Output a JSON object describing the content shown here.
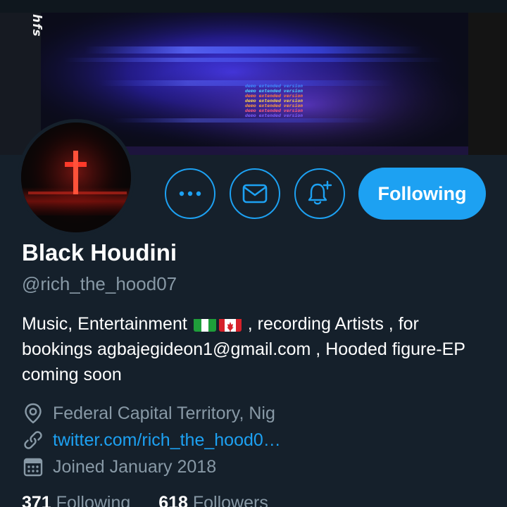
{
  "banner": {
    "overlay_text": "hfs",
    "demo_lines": [
      "demo extended version",
      "demo extended version",
      "demo extended version",
      "demo extended version",
      "demo extended version",
      "demo extended version",
      "demo extended version"
    ]
  },
  "actions": {
    "more_icon": "more-horizontal-icon",
    "message_icon": "envelope-icon",
    "notify_icon": "bell-plus-icon",
    "following_label": "Following"
  },
  "profile": {
    "display_name": "Black Houdini",
    "handle": "@rich_the_hood07",
    "bio_part1": "Music, Entertainment",
    "bio_part2": ", recording Artists , for bookings agbajegideon1@gmail.com , Hooded figure-EP coming soon",
    "flags": [
      "nigeria-flag",
      "canada-flag"
    ],
    "location": "Federal Capital Territory, Nig",
    "website": "twitter.com/rich_the_hood0…",
    "joined": "Joined January 2018"
  },
  "stats": {
    "following_count": "371",
    "following_label": "Following",
    "followers_count": "618",
    "followers_label": "Followers"
  },
  "colors": {
    "background": "#15202b",
    "accent": "#1da1f2",
    "secondary_text": "#8899a6",
    "primary_text": "#ffffff"
  }
}
